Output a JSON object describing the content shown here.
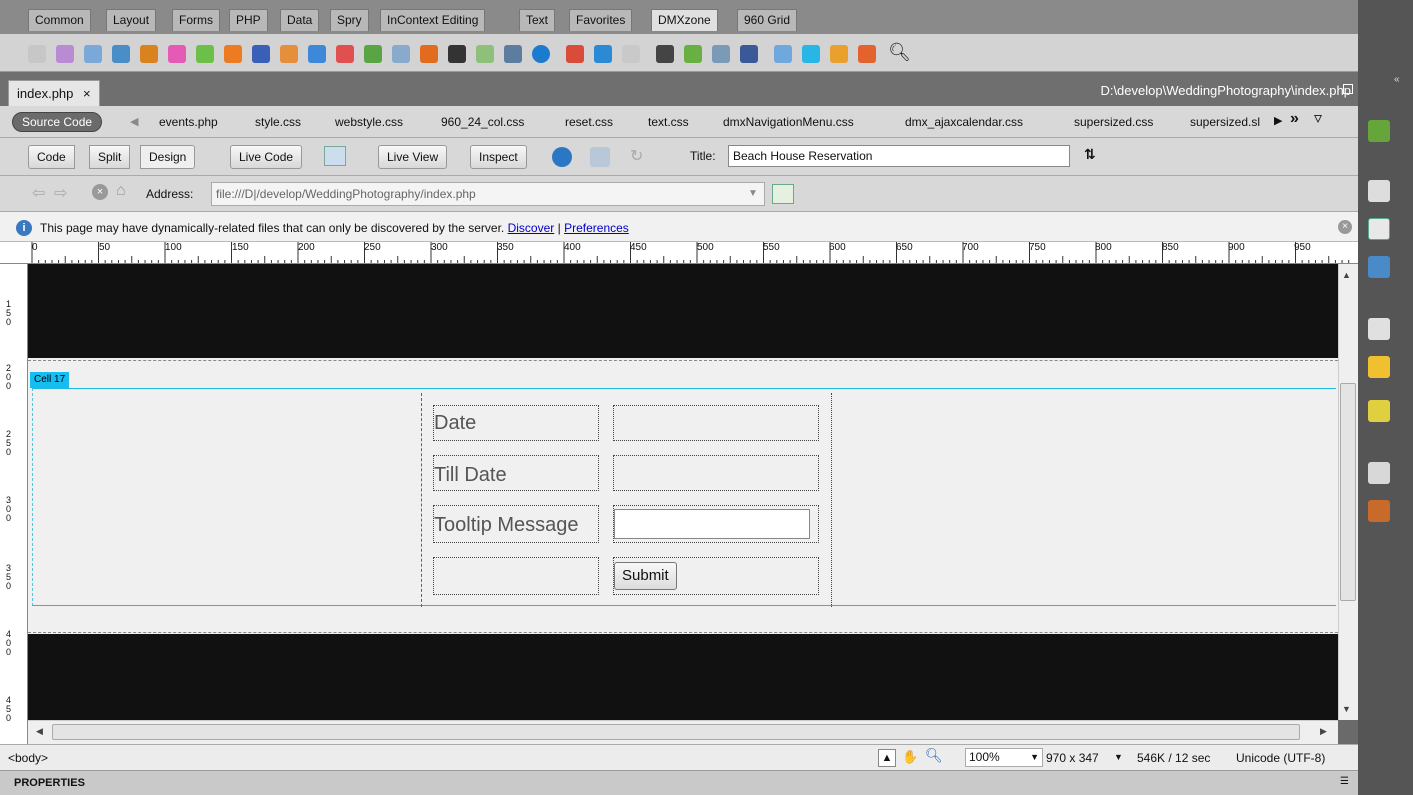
{
  "insert_tabs": [
    "Common",
    "Layout",
    "Forms",
    "PHP",
    "Data",
    "Spry",
    "InContext Editing",
    "Text",
    "Favorites",
    "DMXzone",
    "960 Grid"
  ],
  "active_insert_tab": "DMXzone",
  "document": {
    "tab_label": "index.php",
    "close_glyph": "×",
    "path": "D:\\develop\\WeddingPhotography\\index.php"
  },
  "related_files": {
    "source_code": "Source Code",
    "files": [
      "events.php",
      "style.css",
      "webstyle.css",
      "960_24_col.css",
      "reset.css",
      "text.css",
      "dmxNavigationMenu.css",
      "dmx_ajaxcalendar.css",
      "supersized.css",
      "supersized.sl"
    ]
  },
  "doc_toolbar": {
    "code": "Code",
    "split": "Split",
    "design": "Design",
    "live_code": "Live Code",
    "live_view": "Live View",
    "inspect": "Inspect",
    "title_label": "Title:",
    "title_value": "Beach House Reservation"
  },
  "nav": {
    "address_label": "Address:",
    "address_value": "file:///D|/develop/WeddingPhotography/index.php"
  },
  "info_bar": {
    "message": "This page may have dynamically-related files that can only be discovered by the server.",
    "discover": "Discover",
    "separator": "|",
    "preferences": "Preferences"
  },
  "rulers": {
    "top_ticks": [
      "0",
      "50",
      "100",
      "150",
      "200",
      "250",
      "300",
      "350",
      "400",
      "450",
      "500",
      "550",
      "600",
      "650",
      "700",
      "750",
      "800",
      "850",
      "900",
      "950"
    ],
    "left_ticks": [
      "150",
      "200",
      "250",
      "300",
      "350",
      "400",
      "450"
    ]
  },
  "canvas": {
    "cell_label": "Cell 17",
    "form": {
      "date_label": "Date",
      "till_date_label": "Till Date",
      "tooltip_label": "Tooltip Message",
      "submit_label": "Submit"
    }
  },
  "status_bar": {
    "tag": "<body>",
    "zoom": "100%",
    "dimensions": "970 x 347",
    "size": "546K / 12 sec",
    "encoding": "Unicode (UTF-8)"
  },
  "properties": {
    "label": "PROPERTIES"
  },
  "colors": {
    "cell_highlight": "#16bdf0",
    "link": "#0000cc",
    "canvas_black": "#111111"
  }
}
